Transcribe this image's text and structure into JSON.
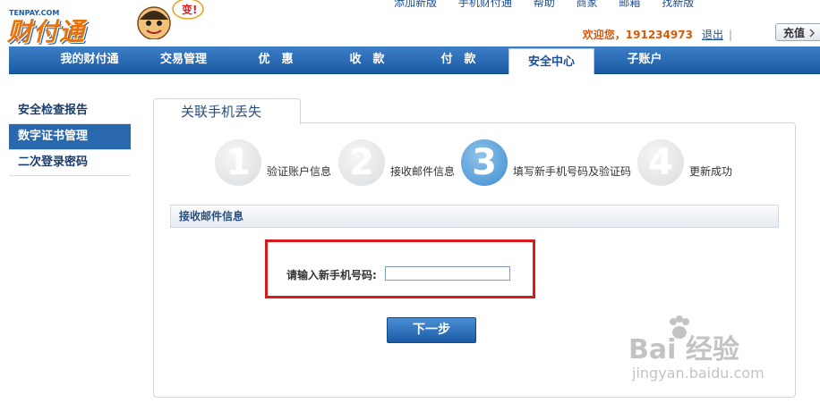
{
  "header": {
    "logo_small": "TENPAY.COM",
    "logo_main": "财付通",
    "top_links": [
      "添加新版",
      "手机财付通",
      "帮助",
      "商家",
      "邮箱",
      "找新版"
    ],
    "welcome_prefix": "欢迎您，",
    "username": "191234973",
    "logout_label": "退出",
    "recharge_label": "充值"
  },
  "nav": {
    "items": [
      "我的财付通",
      "交易管理",
      "优　惠",
      "收　款",
      "付　款",
      "安全中心",
      "子账户"
    ],
    "active_index": 5
  },
  "sidebar": {
    "items": [
      "安全检查报告",
      "数字证书管理",
      "二次登录密码"
    ],
    "active_index": 1
  },
  "panel": {
    "tab_title": "关联手机丢失",
    "steps": [
      {
        "num": "1",
        "label": "验证账户信息"
      },
      {
        "num": "2",
        "label": "接收邮件信息"
      },
      {
        "num": "3",
        "label": "填写新手机号码及验证码"
      },
      {
        "num": "4",
        "label": "更新成功"
      }
    ],
    "active_step": 3,
    "section_title": "接收邮件信息",
    "phone_label": "请输入新手机号码:",
    "phone_value": "",
    "next_label": "下一步"
  },
  "watermark": {
    "brand": "Bai 经验",
    "url": "jingyan.baidu.com"
  },
  "colors": {
    "nav_bg": "#2a68ad",
    "accent_orange": "#e8720a",
    "highlight_red": "#d51b1b",
    "active_step": "#3f8ed0"
  }
}
